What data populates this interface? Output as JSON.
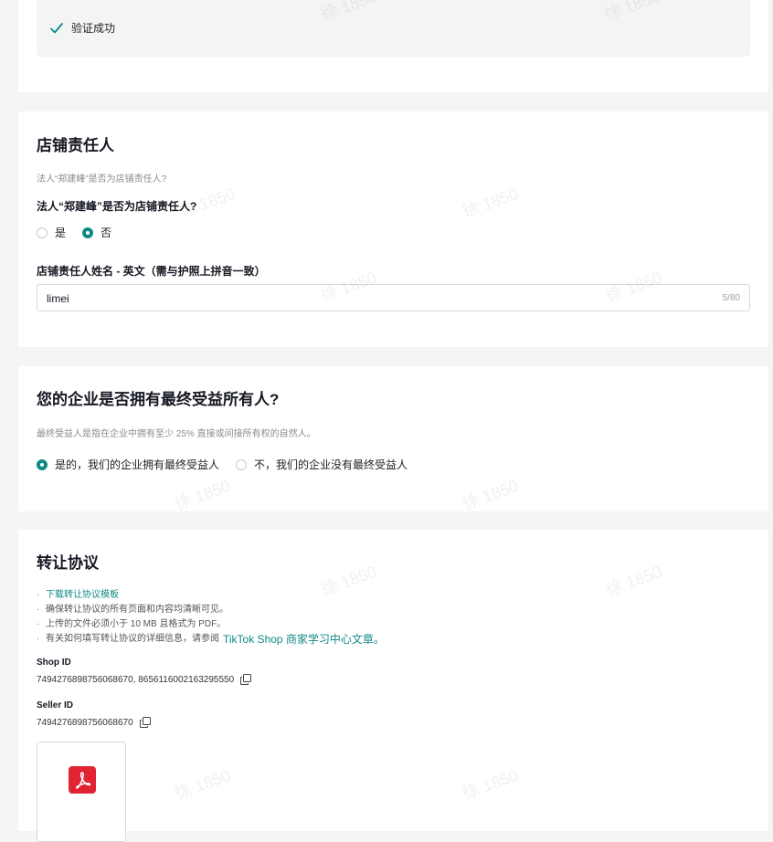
{
  "verification": {
    "status_text": "验证成功"
  },
  "owner_section": {
    "title": "店铺责任人",
    "hint": "法人“郑建峰”是否为店铺责任人?",
    "question": "法人“郑建峰”是否为店铺责任人?",
    "options": [
      {
        "label": "是",
        "checked": false
      },
      {
        "label": "否",
        "checked": true
      }
    ],
    "name_label": "店铺责任人姓名 - 英文（需与护照上拼音一致）",
    "name_value": "limei",
    "char_count": "5/80"
  },
  "ubo_section": {
    "title": "您的企业是否拥有最终受益所有人?",
    "hint": "最终受益人是指在企业中拥有至少 25% 直接或间接所有权的自然人。",
    "options": [
      {
        "label": "是的，我们的企业拥有最终受益人",
        "checked": true
      },
      {
        "label": "不，我们的企业没有最终受益人",
        "checked": false
      }
    ]
  },
  "transfer_section": {
    "title": "转让协议",
    "download_link": "下载转让协议模板",
    "bullets": [
      "确保转让协议的所有页面和内容均清晰可见。",
      "上传的文件必须小于 10 MB 且格式为 PDF。"
    ],
    "info_prefix": "有关如何填写转让协议的详细信息，请参阅",
    "info_link": "TikTok Shop 商家学习中心文章。",
    "shop_id_label": "Shop ID",
    "shop_id_value": "7494276898756068670, 8656116002163295550",
    "seller_id_label": "Seller ID",
    "seller_id_value": "7494276898756068670",
    "upload_icon": "pdf-icon"
  },
  "watermark_text": "徐 1850",
  "colors": {
    "accent": "#0e8a86",
    "pdf_red": "#e02434"
  }
}
